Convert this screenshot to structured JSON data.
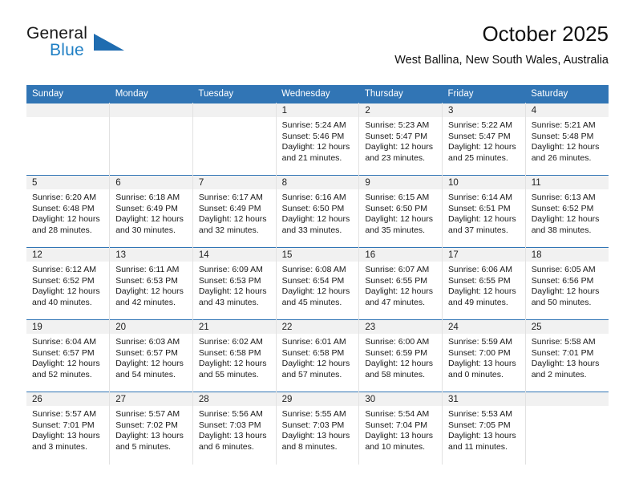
{
  "brand": {
    "name_top": "General",
    "name_bottom": "Blue",
    "triangle_color": "#1f6cb0",
    "blue_text_color": "#1f7fc4"
  },
  "header": {
    "title": "October 2025",
    "subtitle": "West Ballina, New South Wales, Australia"
  },
  "theme": {
    "header_row_bg": "#3175b5",
    "daynum_bg": "#f1f1f1",
    "cell_border": "#e2e2e2",
    "row_rule": "#3175b5"
  },
  "weekday_headers": [
    "Sunday",
    "Monday",
    "Tuesday",
    "Wednesday",
    "Thursday",
    "Friday",
    "Saturday"
  ],
  "labels": {
    "sunrise_prefix": "Sunrise:",
    "sunset_prefix": "Sunset:",
    "daylight_prefix": "Daylight:"
  },
  "weeks": [
    [
      {
        "day": "",
        "empty": true,
        "sunrise": "",
        "sunset": "",
        "daylight_1": "",
        "daylight_2": ""
      },
      {
        "day": "",
        "empty": true,
        "sunrise": "",
        "sunset": "",
        "daylight_1": "",
        "daylight_2": ""
      },
      {
        "day": "",
        "empty": true,
        "sunrise": "",
        "sunset": "",
        "daylight_1": "",
        "daylight_2": ""
      },
      {
        "day": "1",
        "empty": false,
        "sunrise": "Sunrise: 5:24 AM",
        "sunset": "Sunset: 5:46 PM",
        "daylight_1": "Daylight: 12 hours",
        "daylight_2": "and 21 minutes."
      },
      {
        "day": "2",
        "empty": false,
        "sunrise": "Sunrise: 5:23 AM",
        "sunset": "Sunset: 5:47 PM",
        "daylight_1": "Daylight: 12 hours",
        "daylight_2": "and 23 minutes."
      },
      {
        "day": "3",
        "empty": false,
        "sunrise": "Sunrise: 5:22 AM",
        "sunset": "Sunset: 5:47 PM",
        "daylight_1": "Daylight: 12 hours",
        "daylight_2": "and 25 minutes."
      },
      {
        "day": "4",
        "empty": false,
        "sunrise": "Sunrise: 5:21 AM",
        "sunset": "Sunset: 5:48 PM",
        "daylight_1": "Daylight: 12 hours",
        "daylight_2": "and 26 minutes."
      }
    ],
    [
      {
        "day": "5",
        "empty": false,
        "sunrise": "Sunrise: 6:20 AM",
        "sunset": "Sunset: 6:48 PM",
        "daylight_1": "Daylight: 12 hours",
        "daylight_2": "and 28 minutes."
      },
      {
        "day": "6",
        "empty": false,
        "sunrise": "Sunrise: 6:18 AM",
        "sunset": "Sunset: 6:49 PM",
        "daylight_1": "Daylight: 12 hours",
        "daylight_2": "and 30 minutes."
      },
      {
        "day": "7",
        "empty": false,
        "sunrise": "Sunrise: 6:17 AM",
        "sunset": "Sunset: 6:49 PM",
        "daylight_1": "Daylight: 12 hours",
        "daylight_2": "and 32 minutes."
      },
      {
        "day": "8",
        "empty": false,
        "sunrise": "Sunrise: 6:16 AM",
        "sunset": "Sunset: 6:50 PM",
        "daylight_1": "Daylight: 12 hours",
        "daylight_2": "and 33 minutes."
      },
      {
        "day": "9",
        "empty": false,
        "sunrise": "Sunrise: 6:15 AM",
        "sunset": "Sunset: 6:50 PM",
        "daylight_1": "Daylight: 12 hours",
        "daylight_2": "and 35 minutes."
      },
      {
        "day": "10",
        "empty": false,
        "sunrise": "Sunrise: 6:14 AM",
        "sunset": "Sunset: 6:51 PM",
        "daylight_1": "Daylight: 12 hours",
        "daylight_2": "and 37 minutes."
      },
      {
        "day": "11",
        "empty": false,
        "sunrise": "Sunrise: 6:13 AM",
        "sunset": "Sunset: 6:52 PM",
        "daylight_1": "Daylight: 12 hours",
        "daylight_2": "and 38 minutes."
      }
    ],
    [
      {
        "day": "12",
        "empty": false,
        "sunrise": "Sunrise: 6:12 AM",
        "sunset": "Sunset: 6:52 PM",
        "daylight_1": "Daylight: 12 hours",
        "daylight_2": "and 40 minutes."
      },
      {
        "day": "13",
        "empty": false,
        "sunrise": "Sunrise: 6:11 AM",
        "sunset": "Sunset: 6:53 PM",
        "daylight_1": "Daylight: 12 hours",
        "daylight_2": "and 42 minutes."
      },
      {
        "day": "14",
        "empty": false,
        "sunrise": "Sunrise: 6:09 AM",
        "sunset": "Sunset: 6:53 PM",
        "daylight_1": "Daylight: 12 hours",
        "daylight_2": "and 43 minutes."
      },
      {
        "day": "15",
        "empty": false,
        "sunrise": "Sunrise: 6:08 AM",
        "sunset": "Sunset: 6:54 PM",
        "daylight_1": "Daylight: 12 hours",
        "daylight_2": "and 45 minutes."
      },
      {
        "day": "16",
        "empty": false,
        "sunrise": "Sunrise: 6:07 AM",
        "sunset": "Sunset: 6:55 PM",
        "daylight_1": "Daylight: 12 hours",
        "daylight_2": "and 47 minutes."
      },
      {
        "day": "17",
        "empty": false,
        "sunrise": "Sunrise: 6:06 AM",
        "sunset": "Sunset: 6:55 PM",
        "daylight_1": "Daylight: 12 hours",
        "daylight_2": "and 49 minutes."
      },
      {
        "day": "18",
        "empty": false,
        "sunrise": "Sunrise: 6:05 AM",
        "sunset": "Sunset: 6:56 PM",
        "daylight_1": "Daylight: 12 hours",
        "daylight_2": "and 50 minutes."
      }
    ],
    [
      {
        "day": "19",
        "empty": false,
        "sunrise": "Sunrise: 6:04 AM",
        "sunset": "Sunset: 6:57 PM",
        "daylight_1": "Daylight: 12 hours",
        "daylight_2": "and 52 minutes."
      },
      {
        "day": "20",
        "empty": false,
        "sunrise": "Sunrise: 6:03 AM",
        "sunset": "Sunset: 6:57 PM",
        "daylight_1": "Daylight: 12 hours",
        "daylight_2": "and 54 minutes."
      },
      {
        "day": "21",
        "empty": false,
        "sunrise": "Sunrise: 6:02 AM",
        "sunset": "Sunset: 6:58 PM",
        "daylight_1": "Daylight: 12 hours",
        "daylight_2": "and 55 minutes."
      },
      {
        "day": "22",
        "empty": false,
        "sunrise": "Sunrise: 6:01 AM",
        "sunset": "Sunset: 6:58 PM",
        "daylight_1": "Daylight: 12 hours",
        "daylight_2": "and 57 minutes."
      },
      {
        "day": "23",
        "empty": false,
        "sunrise": "Sunrise: 6:00 AM",
        "sunset": "Sunset: 6:59 PM",
        "daylight_1": "Daylight: 12 hours",
        "daylight_2": "and 58 minutes."
      },
      {
        "day": "24",
        "empty": false,
        "sunrise": "Sunrise: 5:59 AM",
        "sunset": "Sunset: 7:00 PM",
        "daylight_1": "Daylight: 13 hours",
        "daylight_2": "and 0 minutes."
      },
      {
        "day": "25",
        "empty": false,
        "sunrise": "Sunrise: 5:58 AM",
        "sunset": "Sunset: 7:01 PM",
        "daylight_1": "Daylight: 13 hours",
        "daylight_2": "and 2 minutes."
      }
    ],
    [
      {
        "day": "26",
        "empty": false,
        "sunrise": "Sunrise: 5:57 AM",
        "sunset": "Sunset: 7:01 PM",
        "daylight_1": "Daylight: 13 hours",
        "daylight_2": "and 3 minutes."
      },
      {
        "day": "27",
        "empty": false,
        "sunrise": "Sunrise: 5:57 AM",
        "sunset": "Sunset: 7:02 PM",
        "daylight_1": "Daylight: 13 hours",
        "daylight_2": "and 5 minutes."
      },
      {
        "day": "28",
        "empty": false,
        "sunrise": "Sunrise: 5:56 AM",
        "sunset": "Sunset: 7:03 PM",
        "daylight_1": "Daylight: 13 hours",
        "daylight_2": "and 6 minutes."
      },
      {
        "day": "29",
        "empty": false,
        "sunrise": "Sunrise: 5:55 AM",
        "sunset": "Sunset: 7:03 PM",
        "daylight_1": "Daylight: 13 hours",
        "daylight_2": "and 8 minutes."
      },
      {
        "day": "30",
        "empty": false,
        "sunrise": "Sunrise: 5:54 AM",
        "sunset": "Sunset: 7:04 PM",
        "daylight_1": "Daylight: 13 hours",
        "daylight_2": "and 10 minutes."
      },
      {
        "day": "31",
        "empty": false,
        "sunrise": "Sunrise: 5:53 AM",
        "sunset": "Sunset: 7:05 PM",
        "daylight_1": "Daylight: 13 hours",
        "daylight_2": "and 11 minutes."
      },
      {
        "day": "",
        "empty": true,
        "sunrise": "",
        "sunset": "",
        "daylight_1": "",
        "daylight_2": ""
      }
    ]
  ]
}
